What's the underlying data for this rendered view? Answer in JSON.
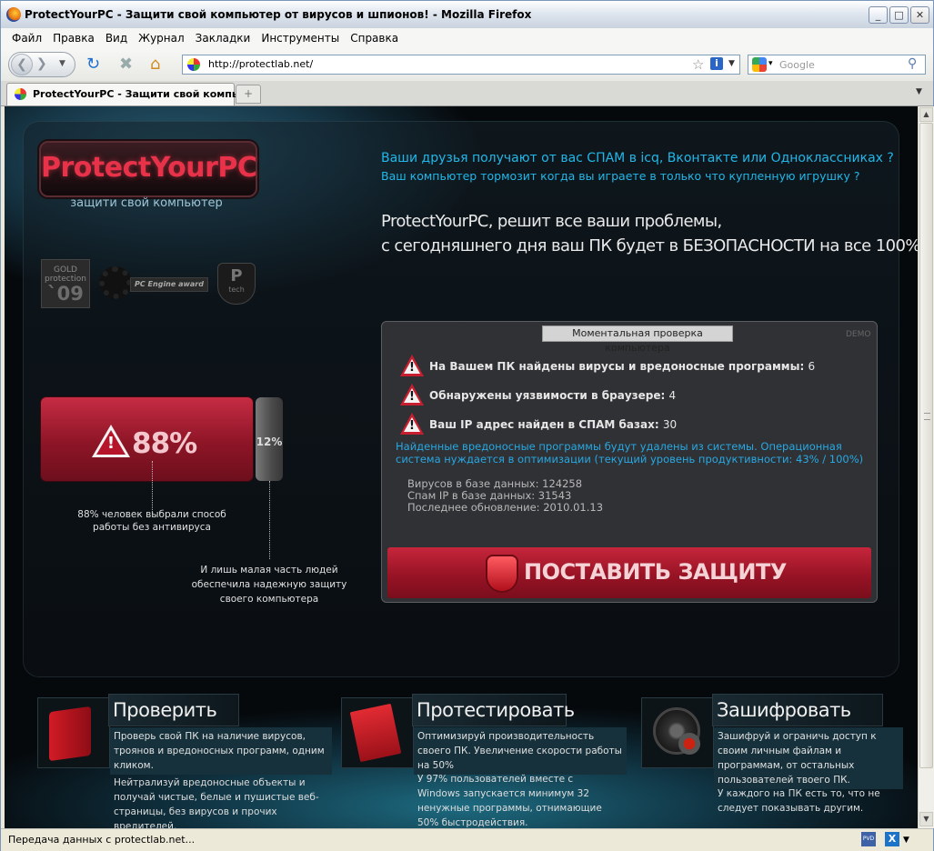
{
  "window": {
    "title": "ProtectYourPC - Защити свой компьютер от вирусов и шпионов! - Mozilla Firefox",
    "minimize": "_",
    "maximize": "□",
    "close": "✕"
  },
  "menu": [
    "Файл",
    "Правка",
    "Вид",
    "Журнал",
    "Закладки",
    "Инструменты",
    "Справка"
  ],
  "toolbar": {
    "url": "http://protectlab.net/",
    "search_placeholder": "Google"
  },
  "tab": {
    "label": "ProtectYourPC - Защити свой компь...",
    "new_tab": "+"
  },
  "page": {
    "logo": "ProtectYourPC",
    "tagline": "защити свой компьютер",
    "badges": {
      "gold_line1": "GOLD",
      "gold_line2": "protection",
      "gold_year": "`09",
      "award": "PC Engine award",
      "ptech_p": "P",
      "ptech_t": "tech"
    },
    "headline1": "Ваши друзья получают от вас СПАМ в icq, Вконтакте или Одноклассниках  ?",
    "headline2": "Ваш компьютер тормозит когда вы играете в только что купленную игрушку ?",
    "claim1": "ProtectYourPC, решит все ваши проблемы,",
    "claim2": "с сегодняшнего дня  ваш ПК будет в БЕЗОПАСНОСТИ на все 100%",
    "bar_main": {
      "value": 88,
      "label": "88%",
      "note": "88% человек выбрали способ работы без антивируса"
    },
    "bar_small": {
      "value": 12,
      "label": "12%",
      "note": "И лишь малая часть людей обеспечила надежную защиту своего компьютера"
    },
    "check": {
      "caption": "Моментальная проверка компьютера",
      "demo": "DEMO",
      "rows": [
        {
          "label": "На Вашем ПК найдены вирусы и вредоносные программы:",
          "value": "6"
        },
        {
          "label": "Обнаружены уязвимости в браузере:",
          "value": "4"
        },
        {
          "label": "Ваш IP адрес найден в СПАМ базах:",
          "value": "30"
        }
      ],
      "notice": "Найденные вредоносные программы будут удалены из системы. Операционная система нуждается в оптимизации (текущий уровень продуктивности: 43% / 100%)",
      "stats": [
        "Вирусов в базе данных: 124258",
        "Спам IP в базе данных: 31543",
        "Последнее обновление: 2010.01.13"
      ],
      "install_button": "ПОСТАВИТЬ ЗАЩИТУ"
    },
    "features": [
      {
        "title": "Проверить",
        "desc": "Проверь свой ПК на наличие вирусов, троянов и вредоносных программ, одним кликом.",
        "desc2": "Нейтрализуй вредоносные объекты и получай чистые, белые и пушистые веб-страницы, без вирусов и прочих вредителей."
      },
      {
        "title": "Протестировать",
        "desc": "Оптимизируй производительность своего ПК. Увеличение скорости работы на 50%",
        "desc2": "У 97% пользователей вместе с Windows запускается минимум 32 ненужные программы, отнимающие 50% быстродействия."
      },
      {
        "title": "Зашифровать",
        "desc": "Зашифруй и ограничь доступ к своим личным файлам и программам, от остальных пользователей твоего ПК.",
        "desc2": "У каждого на ПК есть то, что не следует показывать другим."
      }
    ]
  },
  "status": {
    "text": "Передача данных с protectlab.net...",
    "pvd": "PVD",
    "x": "X"
  }
}
